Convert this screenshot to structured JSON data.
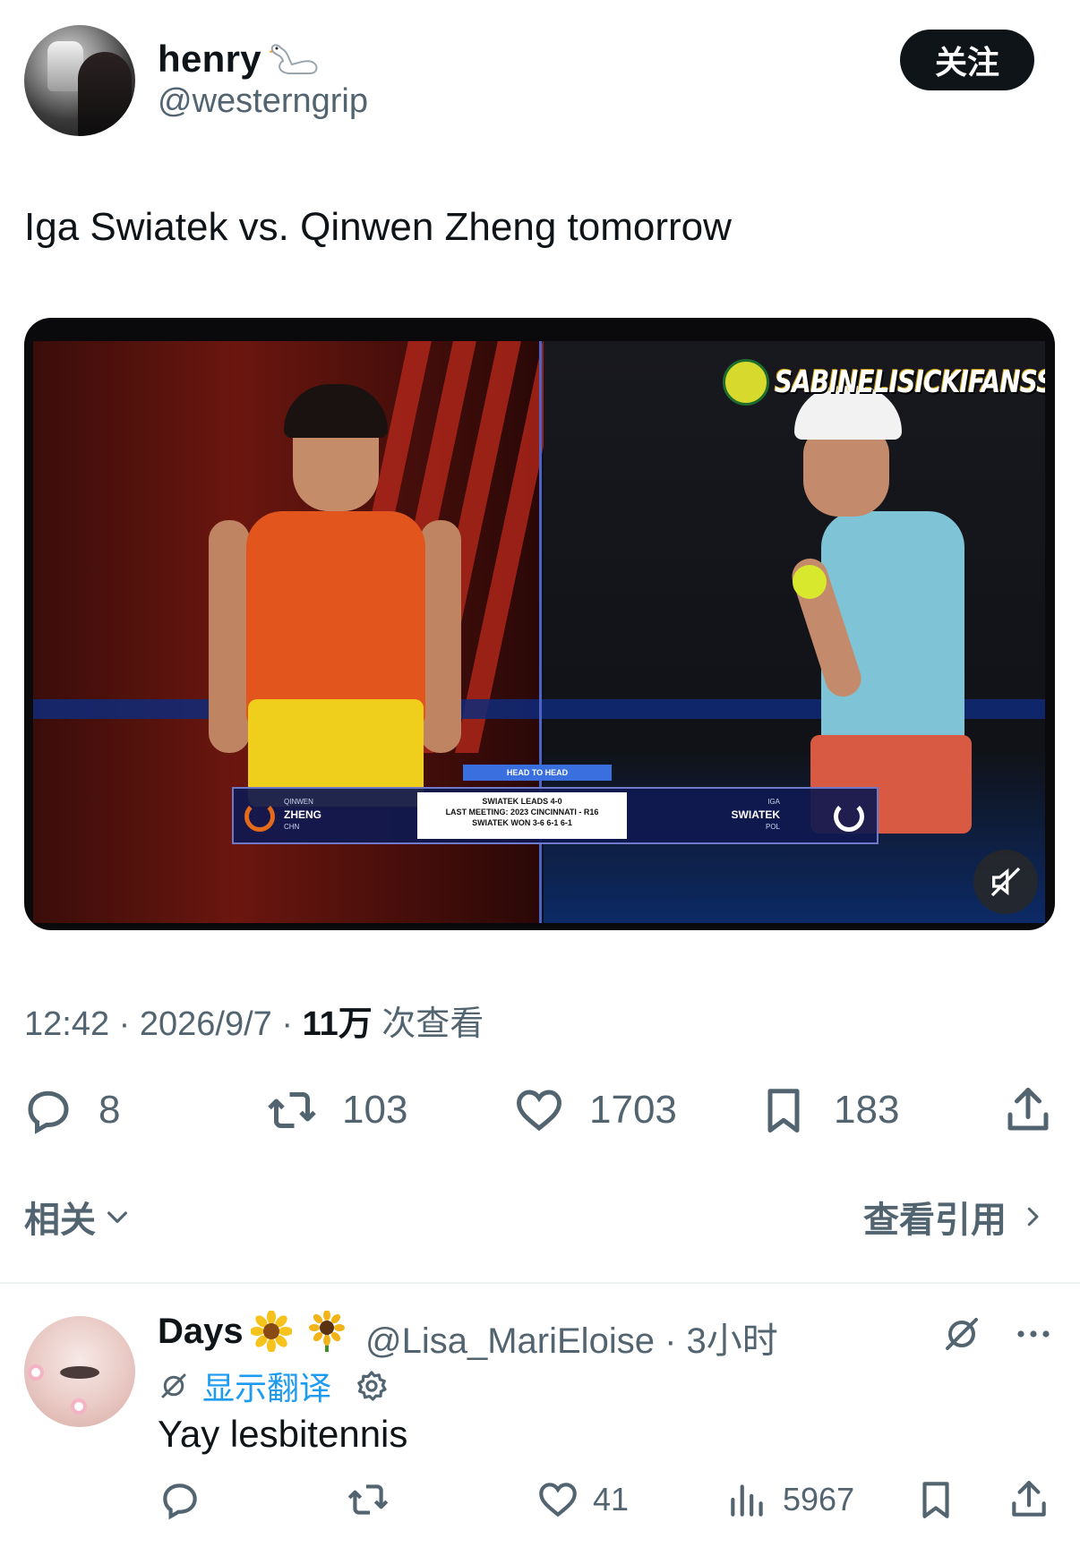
{
  "tweet": {
    "author": {
      "display_name": "henry",
      "badge_icon": "swan-emoji",
      "handle": "@westerngrip"
    },
    "follow_label": "关注",
    "text": "Iga Swiatek vs. Qinwen Zheng tomorrow",
    "media": {
      "watermark": "SABINELISICKIFANSSS",
      "scoreboard": {
        "head_to_head": "HEAD TO HEAD",
        "left_first": "QINWEN",
        "left_last": "ZHENG",
        "left_country": "CHN",
        "center_line1": "SWIATEK LEADS 4-0",
        "center_line2": "LAST MEETING: 2023 CINCINNATI - R16",
        "center_line3": "SWIATEK WON 3-6 6-1 6-1",
        "right_first": "IGA",
        "right_last": "SWIATEK",
        "right_country": "POL"
      },
      "mute_icon": "speaker-muted-icon"
    },
    "meta": {
      "time": "12:42",
      "sep1": " · ",
      "date": "2026/9/7",
      "sep2": " · ",
      "views_count": "11万",
      "views_label": " 次查看"
    },
    "actions": {
      "replies": "8",
      "retweets": "103",
      "likes": "1703",
      "bookmarks": "183"
    },
    "related_label": "相关",
    "view_quotes_label": "查看引用"
  },
  "reply": {
    "display_name": "Days",
    "emojis": [
      "sunflower",
      "sunflower"
    ],
    "handle_time": "@Lisa_MariEloise · 3小时",
    "translate_label": "显示翻译",
    "text": "Yay lesbitennis",
    "actions": {
      "replies": "",
      "retweets": "",
      "likes": "41",
      "views": "5967"
    }
  },
  "colors": {
    "text_primary": "#0f1419",
    "text_secondary": "#536471",
    "link_blue": "#1d9bf0",
    "follow_button_bg": "#0f1419"
  }
}
